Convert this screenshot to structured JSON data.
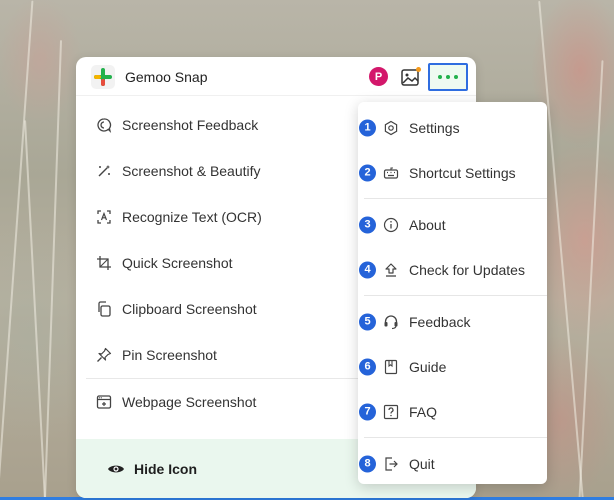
{
  "app": {
    "title": "Gemoo Snap",
    "avatar_letter": "P"
  },
  "menu": {
    "items": [
      {
        "label": "Screenshot Feedback",
        "icon": "feedback-bubble-icon"
      },
      {
        "label": "Screenshot & Beautify",
        "icon": "magic-wand-icon"
      },
      {
        "label": "Recognize Text (OCR)",
        "icon": "ocr-icon"
      },
      {
        "label": "Quick Screenshot",
        "icon": "crop-icon"
      },
      {
        "label": "Clipboard Screenshot",
        "icon": "clipboard-icon"
      },
      {
        "label": "Pin Screenshot",
        "icon": "pin-icon"
      },
      {
        "label": "Webpage Screenshot",
        "icon": "webpage-icon"
      }
    ],
    "hide_label": "Hide Icon"
  },
  "dropdown": {
    "items": [
      {
        "num": "1",
        "label": "Settings",
        "icon": "settings-icon"
      },
      {
        "num": "2",
        "label": "Shortcut Settings",
        "icon": "keyboard-icon"
      },
      {
        "num": "3",
        "label": "About",
        "icon": "info-icon"
      },
      {
        "num": "4",
        "label": "Check for Updates",
        "icon": "upload-icon"
      },
      {
        "num": "5",
        "label": "Feedback",
        "icon": "headset-icon"
      },
      {
        "num": "6",
        "label": "Guide",
        "icon": "book-icon"
      },
      {
        "num": "7",
        "label": "FAQ",
        "icon": "question-icon"
      },
      {
        "num": "8",
        "label": "Quit",
        "icon": "exit-icon"
      }
    ]
  },
  "colors": {
    "accent_green": "#22b14c",
    "highlight_blue": "#2f6de0",
    "badge_blue": "#2563d9",
    "avatar_pink": "#d3176b",
    "hide_bar_bg": "#eaf7ee"
  }
}
